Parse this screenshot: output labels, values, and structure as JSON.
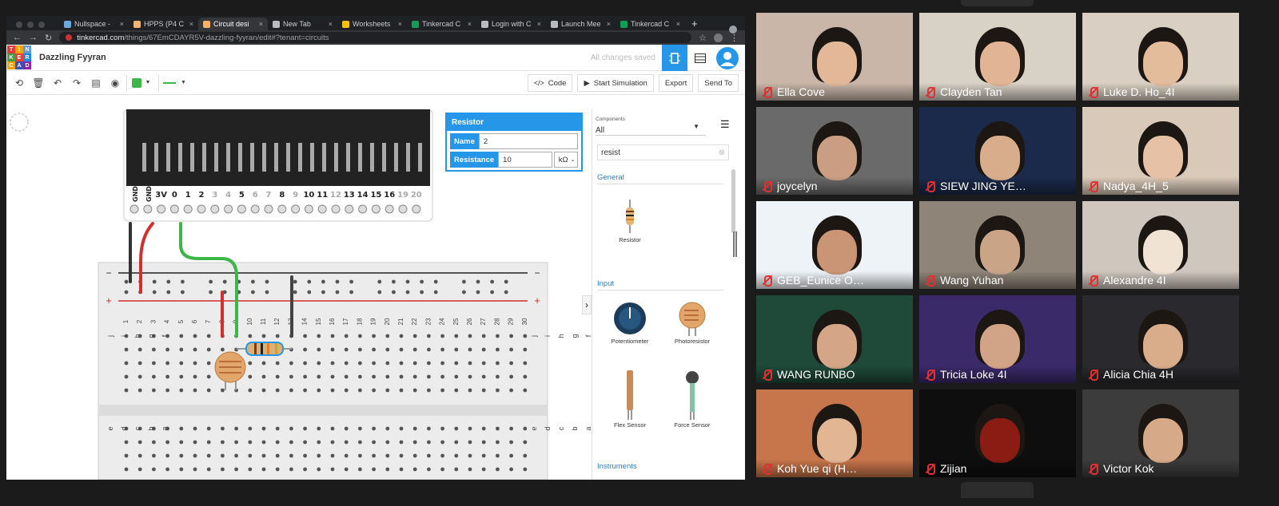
{
  "browser": {
    "tabs": [
      {
        "label": "Nullspace -",
        "color": "#6fa8dc"
      },
      {
        "label": "HPPS (P4 C",
        "color": "#f6b26b"
      },
      {
        "label": "Circuit desi",
        "color": "#f6b26b",
        "active": true
      },
      {
        "label": "New Tab",
        "color": "#bbbbbb"
      },
      {
        "label": "Worksheets",
        "color": "#f4c20d"
      },
      {
        "label": "Tinkercad C",
        "color": "#0f9d58"
      },
      {
        "label": "Login with C",
        "color": "#bbbbbb"
      },
      {
        "label": "Launch Mee",
        "color": "#bbbbbb"
      },
      {
        "label": "Tinkercad C",
        "color": "#0f9d58"
      }
    ],
    "new_tab": "+",
    "url_host": "tinkercad.com",
    "url_path": "/things/67EmCDAYR5V-dazzling-fyyran/edit#?tenant=circuits"
  },
  "tinkercad": {
    "logo_letters": [
      "TIN",
      "KER",
      "CAD"
    ],
    "design_title": "Dazzling Fyyran",
    "save_status": "All changes saved",
    "toolbar": {
      "code": "Code",
      "start_sim": "Start Simulation",
      "export": "Export",
      "send_to": "Send To"
    },
    "inspector": {
      "title": "Resistor",
      "name_label": "Name",
      "name_value": "2",
      "resistance_label": "Resistance",
      "resistance_value": "10",
      "unit": "kΩ"
    },
    "panel": {
      "components_label": "Components",
      "components_value": "All",
      "search_value": "resist",
      "sections": {
        "general": "General",
        "input": "Input",
        "instruments": "Instruments"
      },
      "items": {
        "resistor": "Resistor",
        "potentiometer": "Potentiometer",
        "photoresistor": "Photoresistor",
        "flex": "Flex Sensor",
        "force": "Force Sensor"
      }
    },
    "microbit_pins": [
      "GND",
      "GND",
      "3V",
      "0",
      "1",
      "2",
      "3",
      "4",
      "5",
      "6",
      "7",
      "8",
      "9",
      "10",
      "11",
      "12",
      "13",
      "14",
      "15",
      "16",
      "19",
      "20"
    ],
    "breadboard": {
      "cols": [
        "1",
        "2",
        "3",
        "4",
        "5",
        "6",
        "7",
        "8",
        "9",
        "10",
        "11",
        "12",
        "13",
        "14",
        "15",
        "16",
        "17",
        "18",
        "19",
        "20",
        "21",
        "22",
        "23",
        "24",
        "25",
        "26",
        "27",
        "28",
        "29",
        "30"
      ],
      "rows_top": [
        "j",
        "i",
        "h",
        "g",
        "f"
      ],
      "rows_bottom": [
        "e",
        "d",
        "c",
        "b",
        "a"
      ],
      "plus": "+",
      "minus": "−"
    }
  },
  "participants": [
    {
      "name": "Ella Cove",
      "bg": "#c9b6a8",
      "face": "#e2b899"
    },
    {
      "name": "Clayden Tan",
      "bg": "#d8d1c6",
      "face": "#e0b494"
    },
    {
      "name": "Luke D. Ho_4I",
      "bg": "#d9cfc2",
      "face": "#e3bc9c"
    },
    {
      "name": "joycelyn",
      "bg": "#6a6a6a",
      "face": "#c99e83"
    },
    {
      "name": "SIEW JING YE…",
      "bg": "#1b2a4a",
      "face": "#d8ad8c"
    },
    {
      "name": "Nadya_4H_5",
      "bg": "#d9c9b9",
      "face": "#e6c1a5"
    },
    {
      "name": "GEB_Eunice O…",
      "bg": "#eef3f8",
      "face": "#c99574"
    },
    {
      "name": "Wang Yuhan",
      "bg": "#8e8478",
      "face": "#caa487"
    },
    {
      "name": "Alexandre 4I",
      "bg": "#cfc6bd",
      "face": "#f0e3d3"
    },
    {
      "name": "WANG RUNBO",
      "bg": "#1f4a3a",
      "face": "#d4a687"
    },
    {
      "name": "Tricia Loke 4I",
      "bg": "#3a2a6a",
      "face": "#d2a487"
    },
    {
      "name": "Alicia Chia 4H",
      "bg": "#2a2a2e",
      "face": "#d9ac8a"
    },
    {
      "name": "Koh Yue qi (H…",
      "bg": "#c7754a",
      "face": "#e2b593"
    },
    {
      "name": "Zijian",
      "bg": "#0e0e0e",
      "face": "#8a1c14"
    },
    {
      "name": "Victor Kok",
      "bg": "#3c3c3c",
      "face": "#d6a988"
    }
  ]
}
